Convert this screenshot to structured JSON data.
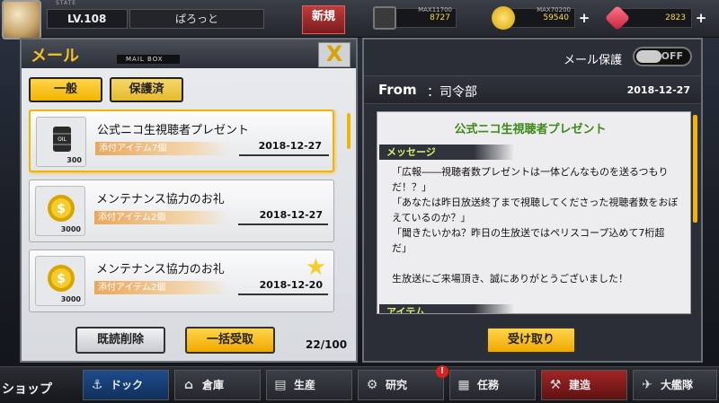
{
  "topbar": {
    "state_label": "STATE",
    "level": "LV.108",
    "player_name": "ぱろっと",
    "new_badge": "新規",
    "fuel": {
      "max": "MAX11700",
      "value": "8727"
    },
    "coin": {
      "max": "MAX70200",
      "value": "59540"
    },
    "gem": {
      "value": "2823"
    }
  },
  "mail": {
    "title": "メール",
    "subtitle": "MAIL BOX",
    "close_label": "X",
    "tabs": [
      "一般",
      "保護済"
    ],
    "items": [
      {
        "title": "公式ニコ生視聴者プレゼント",
        "attachment": "添付アイテム7個",
        "date": "2018-12-27",
        "qty": "300",
        "icon": "oil-drum-icon",
        "starred": false
      },
      {
        "title": "メンテナンス協力のお礼",
        "attachment": "添付アイテム2個",
        "date": "2018-12-27",
        "qty": "3000",
        "icon": "gold-coin-icon",
        "starred": false
      },
      {
        "title": "メンテナンス協力のお礼",
        "attachment": "添付アイテム2個",
        "date": "2018-12-20",
        "qty": "3000",
        "icon": "gold-coin-icon",
        "starred": true
      }
    ],
    "delete_read_label": "既読削除",
    "receive_all_label": "一括受取",
    "count": "22/100"
  },
  "detail": {
    "protect_label": "メール保護",
    "toggle_state": "OFF",
    "from_label": "From",
    "from_name": "：司令部",
    "date": "2018-12-27",
    "title": "公式ニコ生視聴者プレゼント",
    "message_section": "メッセージ",
    "message": "「広報――視聴者数プレゼントは一体どんなものを送るつもりだ！？」\n「あなたは昨日放送終了まで視聴してくださった視聴者数をおぼえているのか？」\n「聞きたいかね？昨日の生放送ではペリスコープ込めて7桁超だ」\n\n生放送にご来場頂き、誠にありがとうございました！",
    "item_section": "アイテム",
    "receive_label": "受け取り"
  },
  "nav": {
    "shop": "ショップ",
    "items": [
      {
        "label": "ドック",
        "icon": "dock-icon",
        "style": "blue"
      },
      {
        "label": "倉庫",
        "icon": "warehouse-icon",
        "style": "normal"
      },
      {
        "label": "生産",
        "icon": "production-icon",
        "style": "normal"
      },
      {
        "label": "研究",
        "icon": "research-icon",
        "style": "normal"
      },
      {
        "label": "任務",
        "icon": "mission-icon",
        "style": "normal"
      },
      {
        "label": "建造",
        "icon": "build-icon",
        "style": "red"
      },
      {
        "label": "大艦隊",
        "icon": "fleet-icon",
        "style": "normal"
      }
    ]
  },
  "colors": {
    "accent": "#f2b400",
    "title_green": "#3a8a14"
  }
}
